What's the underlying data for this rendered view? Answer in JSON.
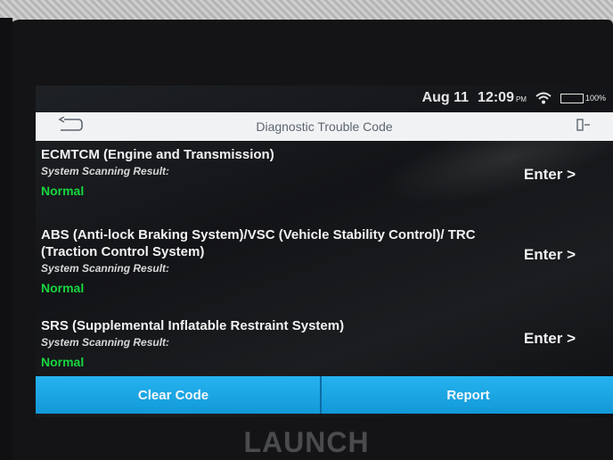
{
  "status_bar": {
    "date": "Aug 11",
    "time": "12:09",
    "ampm": "PM",
    "battery_pct": "100%",
    "battery_level": 1.0,
    "battery_color": "#2ee04a"
  },
  "header": {
    "title": "Diagnostic Trouble Code",
    "back_icon": "back-arrow-icon",
    "exit_icon": "exit-icon"
  },
  "systems": [
    {
      "name": "ECMTCM (Engine and Transmission)",
      "scan_label": "System Scanning Result:",
      "result": "Normal",
      "enter_label": "Enter >"
    },
    {
      "name": "ABS (Anti-lock Braking System)/VSC (Vehicle Stability Control)/ TRC (Traction Control System)",
      "scan_label": "System Scanning Result:",
      "result": "Normal",
      "enter_label": "Enter >"
    },
    {
      "name": "SRS (Supplemental Inflatable Restraint System)",
      "scan_label": "System Scanning Result:",
      "result": "Normal",
      "enter_label": "Enter >"
    }
  ],
  "buttons": {
    "clear_code": "Clear Code",
    "report": "Report"
  },
  "brand": "LAUNCH",
  "colors": {
    "accent": "#1ea7e6",
    "result_ok": "#18d640"
  }
}
